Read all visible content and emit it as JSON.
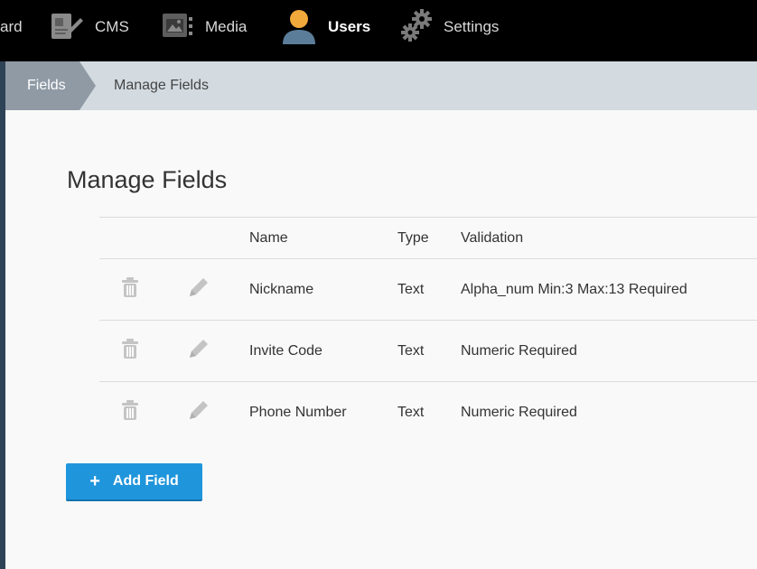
{
  "nav": {
    "items": [
      {
        "label": "ard",
        "icon": "dashboard-icon",
        "active": false
      },
      {
        "label": "CMS",
        "icon": "cms-icon",
        "active": false
      },
      {
        "label": "Media",
        "icon": "media-icon",
        "active": false
      },
      {
        "label": "Users",
        "icon": "user-icon",
        "active": true
      },
      {
        "label": "Settings",
        "icon": "gears-icon",
        "active": false
      }
    ]
  },
  "breadcrumb": {
    "parent": "Fields",
    "current": "Manage Fields"
  },
  "page": {
    "title": "Manage Fields"
  },
  "table": {
    "headers": {
      "name": "Name",
      "type": "Type",
      "validation": "Validation"
    },
    "rows": [
      {
        "name": "Nickname",
        "type": "Text",
        "validation": "Alpha_num Min:3 Max:13 Required"
      },
      {
        "name": "Invite Code",
        "type": "Text",
        "validation": "Numeric Required"
      },
      {
        "name": "Phone Number",
        "type": "Text",
        "validation": "Numeric Required"
      }
    ]
  },
  "actions": {
    "add_field": "Add Field",
    "add_icon": "+"
  },
  "colors": {
    "nav_bg": "#000000",
    "breadcrumb_bg": "#d3dbe1",
    "crumb_active_bg": "#8f9aa5",
    "accent_blue": "#1f95db",
    "user_icon": "#f2a93b"
  }
}
